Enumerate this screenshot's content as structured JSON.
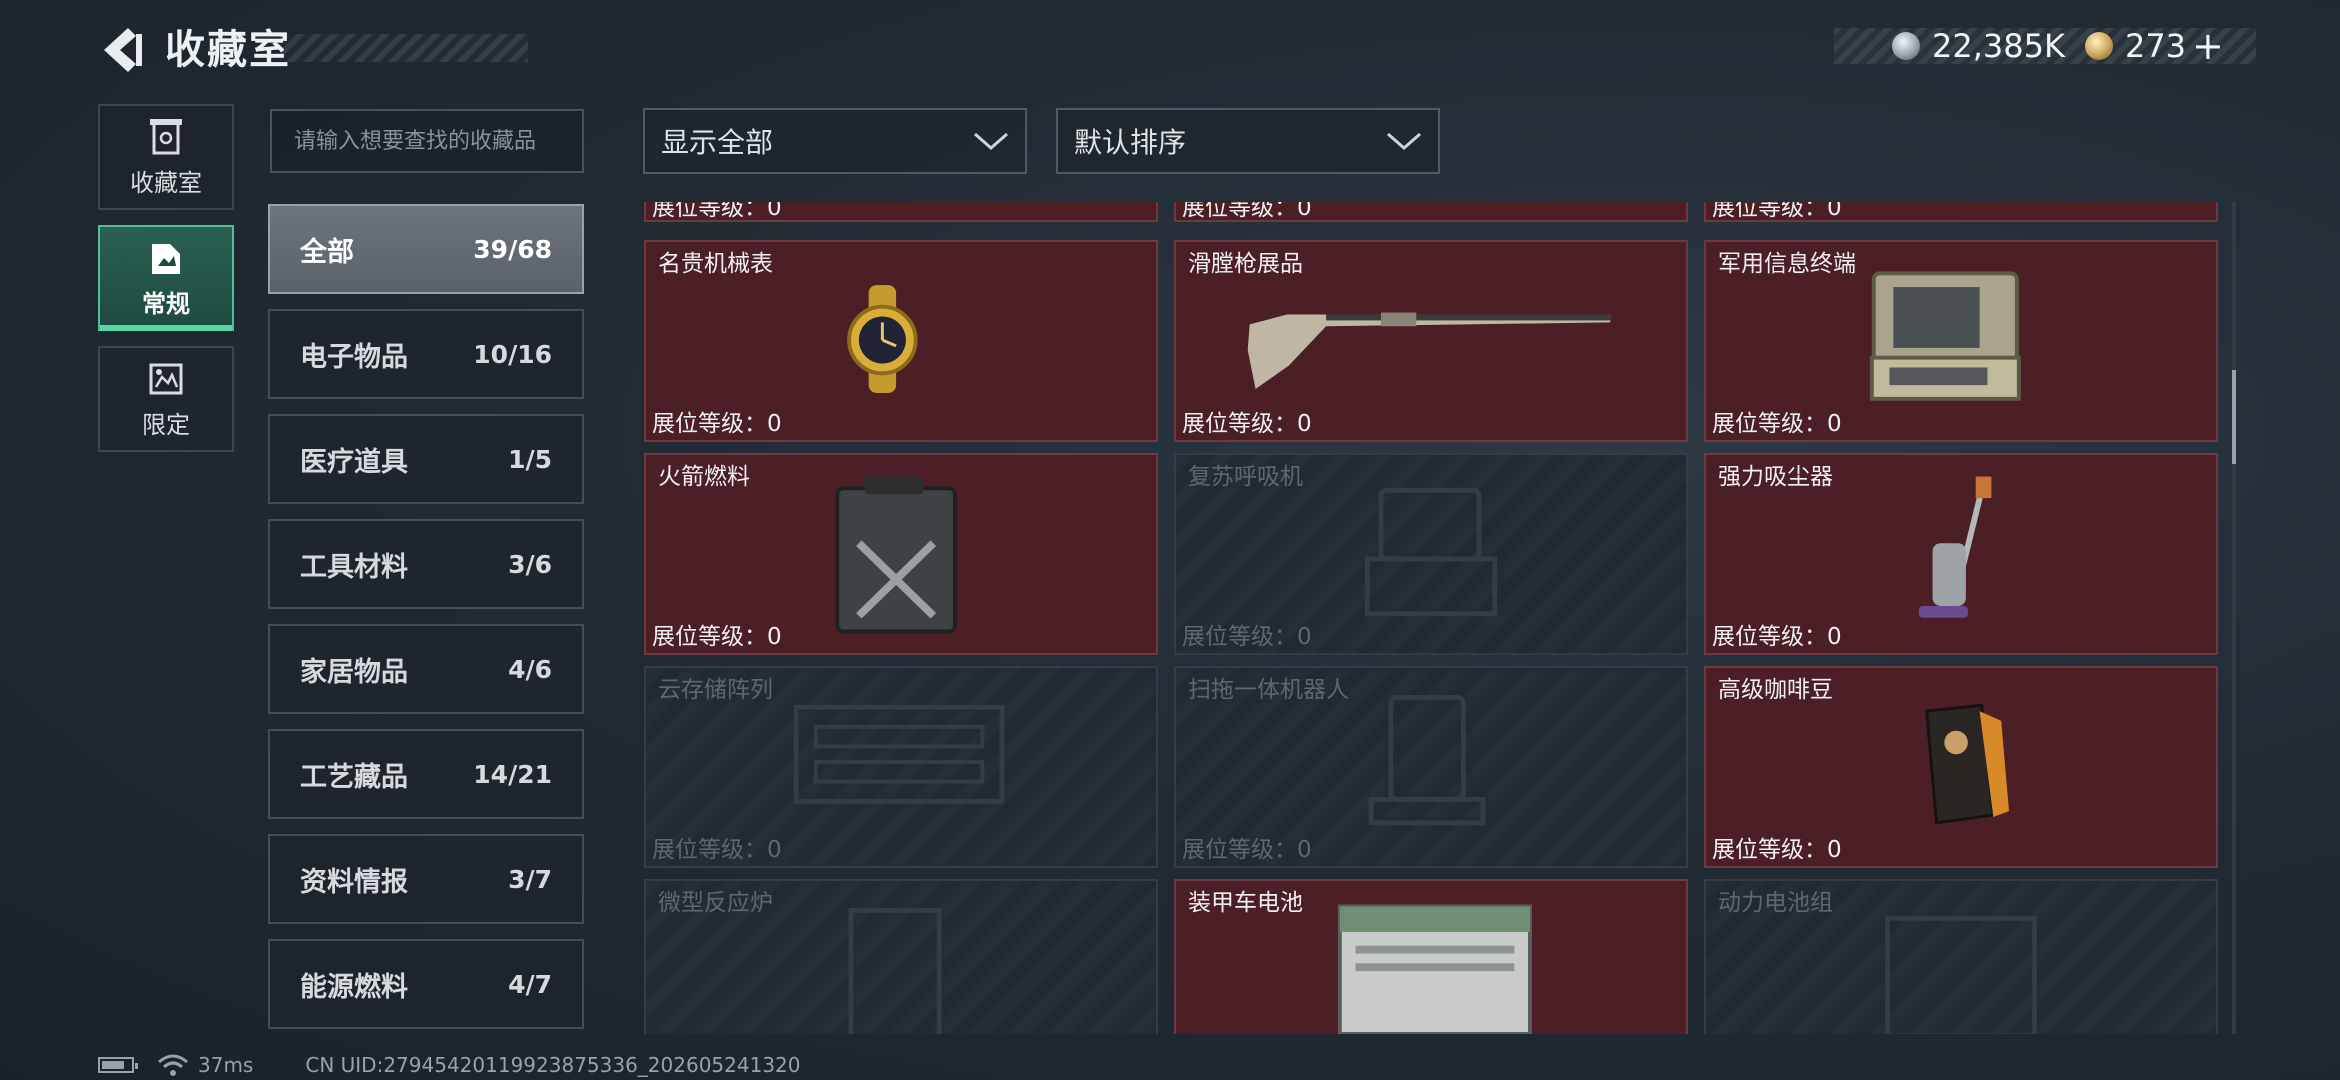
{
  "header": {
    "title": "收藏室",
    "currency_silver": "22,385K",
    "currency_gold": "273",
    "plus": "+",
    "icons": {
      "back": "back-arrow-icon",
      "silver": "silver-coin-icon",
      "gold": "gold-coin-icon"
    }
  },
  "side_tabs": [
    {
      "label": "收藏室",
      "icon": "collection-room-icon"
    },
    {
      "label": "常规",
      "icon": "regular-items-icon"
    },
    {
      "label": "限定",
      "icon": "limited-items-icon"
    }
  ],
  "search": {
    "placeholder": "请输入想要查找的收藏品"
  },
  "categories": [
    {
      "name": "全部",
      "count": "39/68"
    },
    {
      "name": "电子物品",
      "count": "10/16"
    },
    {
      "name": "医疗道具",
      "count": "1/5"
    },
    {
      "name": "工具材料",
      "count": "3/6"
    },
    {
      "name": "家居物品",
      "count": "4/6"
    },
    {
      "name": "工艺藏品",
      "count": "14/21"
    },
    {
      "name": "资料情报",
      "count": "3/7"
    },
    {
      "name": "能源燃料",
      "count": "4/7"
    }
  ],
  "filters": {
    "display": "显示全部",
    "sort": "默认排序"
  },
  "level_label": "展位等级：0",
  "grid": {
    "items": [
      {
        "name": "名贵机械表",
        "unlocked": true
      },
      {
        "name": "滑膛枪展品",
        "unlocked": true
      },
      {
        "name": "军用信息终端",
        "unlocked": true
      },
      {
        "name": "火箭燃料",
        "unlocked": true
      },
      {
        "name": "复苏呼吸机",
        "unlocked": false
      },
      {
        "name": "强力吸尘器",
        "unlocked": true
      },
      {
        "name": "云存储阵列",
        "unlocked": false
      },
      {
        "name": "扫拖一体机器人",
        "unlocked": false
      },
      {
        "name": "高级咖啡豆",
        "unlocked": true
      },
      {
        "name": "微型反应炉",
        "unlocked": false
      },
      {
        "name": "装甲车电池",
        "unlocked": true
      },
      {
        "name": "动力电池组",
        "unlocked": false
      }
    ]
  },
  "footer": {
    "ping": "37ms",
    "uid": "CN UID:279454201199238753​36_202605241320"
  },
  "colors": {
    "accent": "#59d6a5",
    "card_unlocked": "#4b1f25",
    "card_locked": "#262d35"
  }
}
